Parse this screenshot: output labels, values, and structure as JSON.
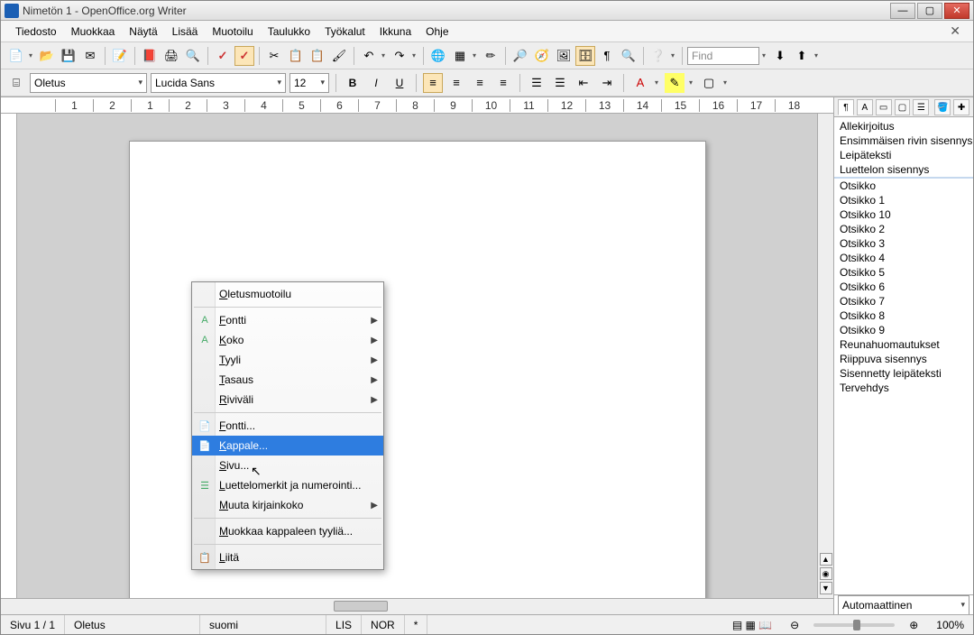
{
  "title": "Nimetön 1 - OpenOffice.org Writer",
  "menubar": [
    "Tiedosto",
    "Muokkaa",
    "Näytä",
    "Lisää",
    "Muotoilu",
    "Taulukko",
    "Työkalut",
    "Ikkuna",
    "Ohje"
  ],
  "format_bar": {
    "style": "Oletus",
    "font": "Lucida Sans",
    "size": "12"
  },
  "find_placeholder": "Find",
  "ruler_numbers": [
    "1",
    "2",
    "1",
    "2",
    "3",
    "4",
    "5",
    "6",
    "7",
    "8",
    "9",
    "10",
    "11",
    "12",
    "13",
    "14",
    "15",
    "16",
    "17",
    "18"
  ],
  "stylist": {
    "items": [
      "Allekirjoitus",
      "Ensimmäisen rivin sisennys",
      "Leipäteksti",
      "Luettelon sisennys",
      "",
      "Otsikko",
      "Otsikko 1",
      "Otsikko 10",
      "Otsikko 2",
      "Otsikko 3",
      "Otsikko 4",
      "Otsikko 5",
      "Otsikko 6",
      "Otsikko 7",
      "Otsikko 8",
      "Otsikko 9",
      "Reunahuomautukset",
      "Riippuva sisennys",
      "Sisennetty leipäteksti",
      "Tervehdys"
    ],
    "selected_index": 4,
    "filter": "Automaattinen"
  },
  "context_menu": {
    "items": [
      {
        "label": "Oletusmuotoilu",
        "submenu": false,
        "icon": ""
      },
      {
        "sep": true
      },
      {
        "label": "Fontti",
        "submenu": true,
        "icon": "A"
      },
      {
        "label": "Koko",
        "submenu": true,
        "icon": "A"
      },
      {
        "label": "Tyyli",
        "submenu": true,
        "icon": ""
      },
      {
        "label": "Tasaus",
        "submenu": true,
        "icon": ""
      },
      {
        "label": "Riviväli",
        "submenu": true,
        "icon": ""
      },
      {
        "sep": true
      },
      {
        "label": "Fontti...",
        "submenu": false,
        "icon": "📄"
      },
      {
        "label": "Kappale...",
        "submenu": false,
        "icon": "📄",
        "highlight": true
      },
      {
        "label": "Sivu...",
        "submenu": false,
        "icon": ""
      },
      {
        "label": "Luettelomerkit ja numerointi...",
        "submenu": false,
        "icon": "☰"
      },
      {
        "label": "Muuta kirjainkoko",
        "submenu": true,
        "icon": ""
      },
      {
        "sep": true
      },
      {
        "label": "Muokkaa kappaleen tyyliä...",
        "submenu": false,
        "icon": ""
      },
      {
        "sep": true
      },
      {
        "label": "Liitä",
        "submenu": false,
        "icon": "📋"
      }
    ]
  },
  "statusbar": {
    "page": "Sivu 1 / 1",
    "style": "Oletus",
    "lang": "suomi",
    "ins": "LIS",
    "nor": "NOR",
    "star": "*",
    "zoom": "100%"
  }
}
